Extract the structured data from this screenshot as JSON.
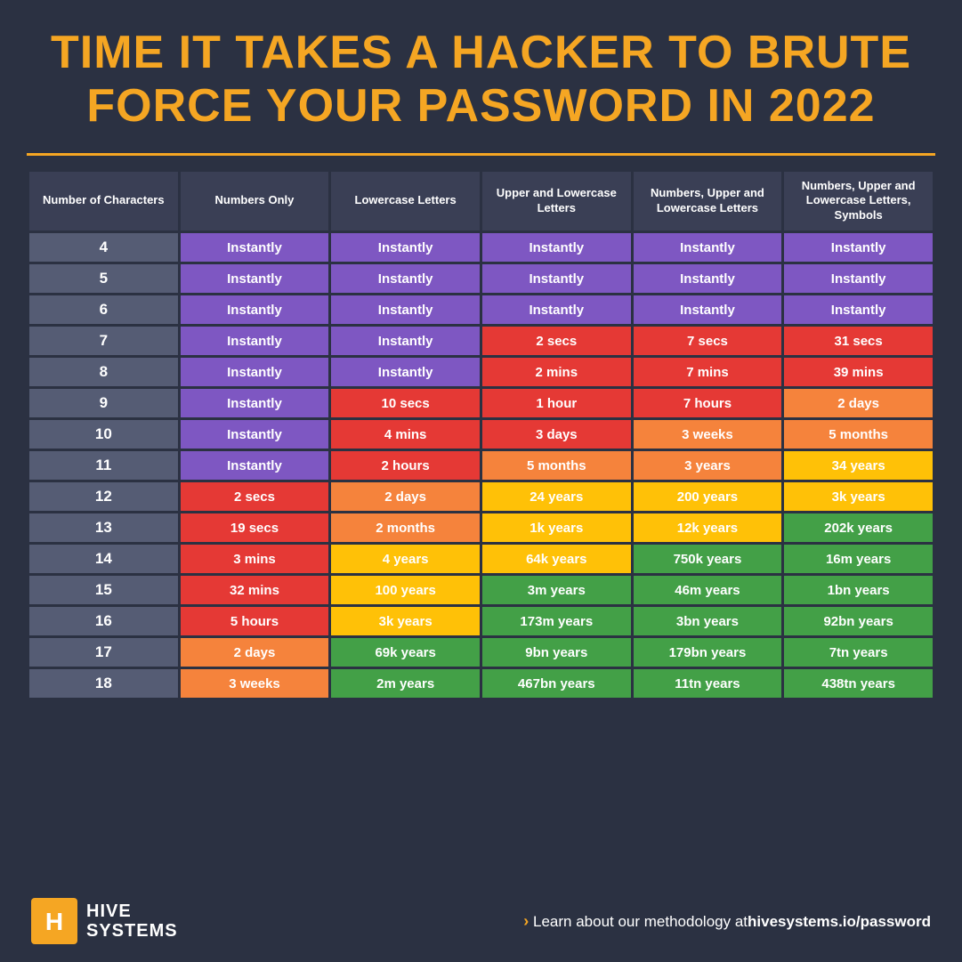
{
  "header": {
    "title_part1": "TIME IT TAKES A HACKER TO BRUTE",
    "title_part2": "FORCE YOUR PASSWORD IN ",
    "year": "2022"
  },
  "columns": [
    "Number of Characters",
    "Numbers Only",
    "Lowercase Letters",
    "Upper and Lowercase Letters",
    "Numbers, Upper and Lowercase Letters",
    "Numbers, Upper and Lowercase Letters, Symbols"
  ],
  "rows": [
    {
      "chars": "4",
      "c1": "Instantly",
      "c2": "Instantly",
      "c3": "Instantly",
      "c4": "Instantly",
      "c5": "Instantly",
      "col1_color": "purple",
      "col2_color": "purple",
      "col3_color": "purple",
      "col4_color": "purple",
      "col5_color": "purple"
    },
    {
      "chars": "5",
      "c1": "Instantly",
      "c2": "Instantly",
      "c3": "Instantly",
      "c4": "Instantly",
      "c5": "Instantly",
      "col1_color": "purple",
      "col2_color": "purple",
      "col3_color": "purple",
      "col4_color": "purple",
      "col5_color": "purple"
    },
    {
      "chars": "6",
      "c1": "Instantly",
      "c2": "Instantly",
      "c3": "Instantly",
      "c4": "Instantly",
      "c5": "Instantly",
      "col1_color": "purple",
      "col2_color": "purple",
      "col3_color": "purple",
      "col4_color": "purple",
      "col5_color": "purple"
    },
    {
      "chars": "7",
      "c1": "Instantly",
      "c2": "Instantly",
      "c3": "2 secs",
      "c4": "7 secs",
      "c5": "31 secs",
      "col1_color": "purple",
      "col2_color": "purple",
      "col3_color": "red",
      "col4_color": "red",
      "col5_color": "red"
    },
    {
      "chars": "8",
      "c1": "Instantly",
      "c2": "Instantly",
      "c3": "2 mins",
      "c4": "7 mins",
      "c5": "39 mins",
      "col1_color": "purple",
      "col2_color": "purple",
      "col3_color": "red",
      "col4_color": "red",
      "col5_color": "red"
    },
    {
      "chars": "9",
      "c1": "Instantly",
      "c2": "10 secs",
      "c3": "1 hour",
      "c4": "7 hours",
      "c5": "2 days",
      "col1_color": "purple",
      "col2_color": "red",
      "col3_color": "red",
      "col4_color": "red",
      "col5_color": "orange"
    },
    {
      "chars": "10",
      "c1": "Instantly",
      "c2": "4 mins",
      "c3": "3 days",
      "c4": "3 weeks",
      "c5": "5 months",
      "col1_color": "purple",
      "col2_color": "red",
      "col3_color": "red",
      "col4_color": "orange",
      "col5_color": "orange"
    },
    {
      "chars": "11",
      "c1": "Instantly",
      "c2": "2 hours",
      "c3": "5 months",
      "c4": "3 years",
      "c5": "34 years",
      "col1_color": "purple",
      "col2_color": "red",
      "col3_color": "orange",
      "col4_color": "orange",
      "col5_color": "yellow"
    },
    {
      "chars": "12",
      "c1": "2 secs",
      "c2": "2 days",
      "c3": "24 years",
      "c4": "200 years",
      "c5": "3k years",
      "col1_color": "red",
      "col2_color": "orange",
      "col3_color": "yellow",
      "col4_color": "yellow",
      "col5_color": "yellow"
    },
    {
      "chars": "13",
      "c1": "19 secs",
      "c2": "2 months",
      "c3": "1k years",
      "c4": "12k years",
      "c5": "202k years",
      "col1_color": "red",
      "col2_color": "orange",
      "col3_color": "yellow",
      "col4_color": "yellow",
      "col5_color": "green"
    },
    {
      "chars": "14",
      "c1": "3 mins",
      "c2": "4 years",
      "c3": "64k years",
      "c4": "750k years",
      "c5": "16m years",
      "col1_color": "red",
      "col2_color": "yellow",
      "col3_color": "yellow",
      "col4_color": "green",
      "col5_color": "green"
    },
    {
      "chars": "15",
      "c1": "32 mins",
      "c2": "100 years",
      "c3": "3m years",
      "c4": "46m years",
      "c5": "1bn years",
      "col1_color": "red",
      "col2_color": "yellow",
      "col3_color": "green",
      "col4_color": "green",
      "col5_color": "green"
    },
    {
      "chars": "16",
      "c1": "5 hours",
      "c2": "3k years",
      "c3": "173m years",
      "c4": "3bn years",
      "c5": "92bn years",
      "col1_color": "red",
      "col2_color": "yellow",
      "col3_color": "green",
      "col4_color": "green",
      "col5_color": "green"
    },
    {
      "chars": "17",
      "c1": "2 days",
      "c2": "69k years",
      "c3": "9bn years",
      "c4": "179bn years",
      "c5": "7tn years",
      "col1_color": "orange",
      "col2_color": "green",
      "col3_color": "green",
      "col4_color": "green",
      "col5_color": "green"
    },
    {
      "chars": "18",
      "c1": "3 weeks",
      "c2": "2m years",
      "c3": "467bn years",
      "c4": "11tn years",
      "c5": "438tn years",
      "col1_color": "orange",
      "col2_color": "green",
      "col3_color": "green",
      "col4_color": "green",
      "col5_color": "green"
    }
  ],
  "footer": {
    "logo_text_line1": "HIVE",
    "logo_text_line2": "SYSTEMS",
    "link_prefix": "› Learn about our methodology at ",
    "link_url": "hivesystems.io/password"
  }
}
